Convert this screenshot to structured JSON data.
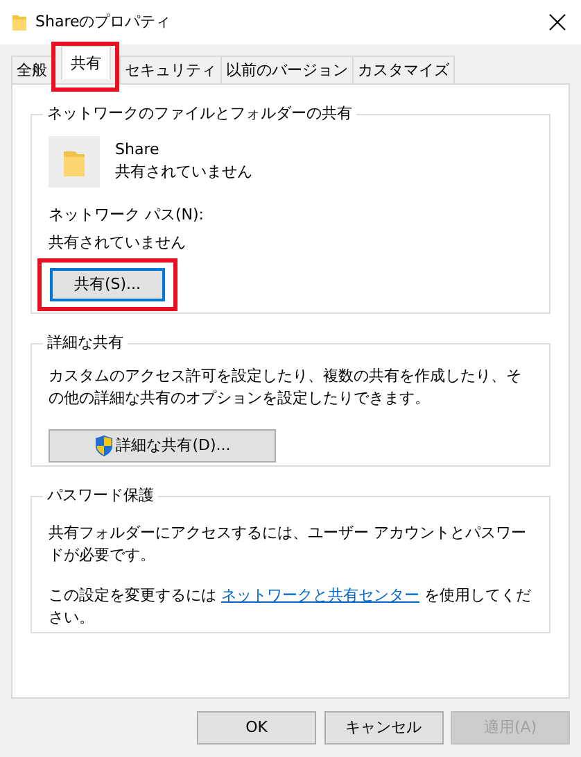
{
  "window": {
    "title": "Shareのプロパティ"
  },
  "tabs": [
    {
      "label": "全般",
      "selected": false,
      "highlighted": false
    },
    {
      "label": "共有",
      "selected": true,
      "highlighted": true
    },
    {
      "label": "セキュリティ",
      "selected": false,
      "highlighted": false
    },
    {
      "label": "以前のバージョン",
      "selected": false,
      "highlighted": false
    },
    {
      "label": "カスタマイズ",
      "selected": false,
      "highlighted": false
    }
  ],
  "network_sharing": {
    "title": "ネットワークのファイルとフォルダーの共有",
    "folder_name": "Share",
    "folder_status": "共有されていません",
    "path_label": "ネットワーク パス(N):",
    "path_value": "共有されていません",
    "button": {
      "label": "共有(S)...",
      "focused": true,
      "highlighted": true
    }
  },
  "advanced_sharing": {
    "title": "詳細な共有",
    "description": "カスタムのアクセス許可を設定したり、複数の共有を作成したり、その他の詳細な共有のオプションを設定したりできます。",
    "button": {
      "label": "詳細な共有(D)...",
      "focused": false,
      "highlighted": false
    }
  },
  "password_protection": {
    "title": "パスワード保護",
    "description": "共有フォルダーにアクセスするには、ユーザー アカウントとパスワードが必要です。",
    "note_before": "この設定を変更するには",
    "link": "ネットワークと共有センター",
    "note_after": "を使用してください。"
  },
  "buttons": [
    {
      "label": "OK",
      "disabled": false
    },
    {
      "label": "キャンセル",
      "disabled": false
    },
    {
      "label": "適用(A)",
      "disabled": true
    }
  ]
}
